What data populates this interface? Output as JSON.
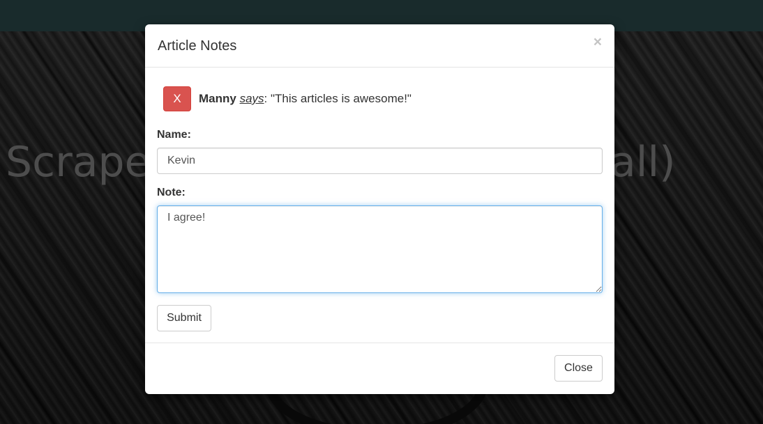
{
  "background": {
    "hero_title": "Scrape the World of Reddit (/all)",
    "topbar_color": "#2f4f51"
  },
  "modal": {
    "title": "Article Notes",
    "close_icon": "×",
    "existing_note": {
      "delete_label": "X",
      "delete_color": "#d9534f",
      "author": "Manny",
      "says": "says",
      "separator": ": ",
      "text": "\"This articles is awesome!\""
    },
    "form": {
      "name_label": "Name:",
      "name_value": "Kevin",
      "note_label": "Note:",
      "note_value": "I agree!",
      "submit_label": "Submit"
    },
    "footer": {
      "close_label": "Close"
    }
  }
}
